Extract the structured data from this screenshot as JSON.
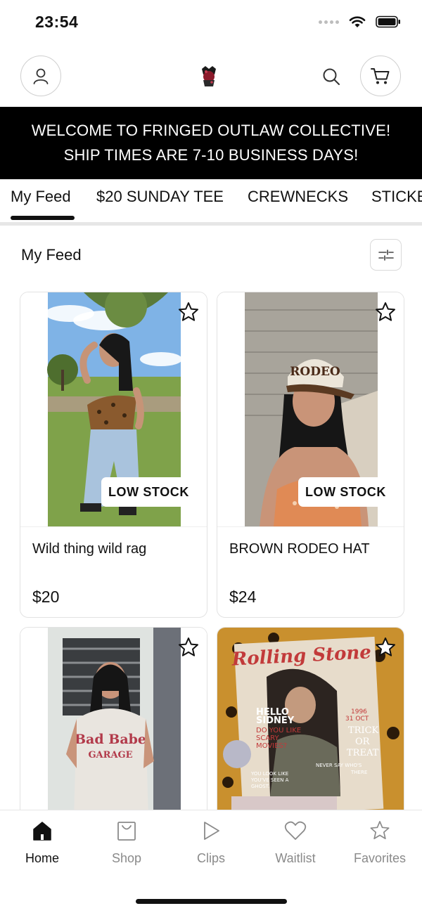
{
  "status_bar": {
    "time": "23:54"
  },
  "banner": {
    "line1": "WELCOME TO FRINGED OUTLAW COLLECTIVE!",
    "line2": "SHIP TIMES ARE 7-10 BUSINESS DAYS!"
  },
  "tabs": [
    {
      "label": "My Feed",
      "active": true
    },
    {
      "label": "$20 SUNDAY TEE"
    },
    {
      "label": "CREWNECKS"
    },
    {
      "label": "STICKERS"
    }
  ],
  "section": {
    "title": "My Feed"
  },
  "products": [
    {
      "title": "Wild thing wild rag",
      "price": "$20",
      "badge": "LOW STOCK"
    },
    {
      "title": "BROWN RODEO HAT",
      "price": "$24",
      "badge": "LOW STOCK"
    },
    {
      "title": "",
      "price": "",
      "badge": ""
    },
    {
      "title": "",
      "price": "",
      "badge": ""
    }
  ],
  "product_images": {
    "hat_text": "RODEO",
    "tee_text_1": "Bad Babe",
    "tee_text_2": "GARAGE",
    "magazine_masthead": "Rolling Stone",
    "magazine_lines": [
      "HELLO",
      "SIDNEY",
      "DO YOU LIKE",
      "SCARY",
      "MOVIES?",
      "1996",
      "31 OCT",
      "TRICK",
      "OR",
      "TREAT",
      "NEVER SAY WHO'S",
      "THERE",
      "YOU LOOK LIKE",
      "YOU'VE SEEN A",
      "GHOST."
    ]
  },
  "bottom_nav": [
    {
      "label": "Home",
      "icon": "home-icon",
      "active": true
    },
    {
      "label": "Shop",
      "icon": "shop-bag-icon"
    },
    {
      "label": "Clips",
      "icon": "play-icon"
    },
    {
      "label": "Waitlist",
      "icon": "heart-icon"
    },
    {
      "label": "Favorites",
      "icon": "star-icon"
    }
  ],
  "colors": {
    "banner_bg": "#000000",
    "text": "#111111",
    "muted": "#8a8a8a"
  }
}
